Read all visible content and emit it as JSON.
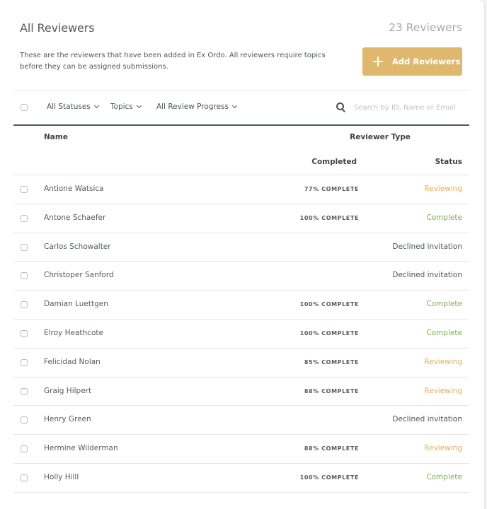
{
  "header": {
    "title": "All Reviewers",
    "count_label": "23 Reviewers",
    "description": "These are the reviewers that have been added in Ex Ordo. All reviewers require topics before they can be assigned submissions.",
    "add_button_label": "Add Reviewers",
    "add_button_icon": "plus-icon"
  },
  "colors": {
    "accent": "#dfb86e",
    "reviewing": "#e5ad55",
    "complete": "#7fad4e",
    "declined": "#4f5458",
    "header_rule": "#4e5860"
  },
  "toolbar": {
    "filters": [
      {
        "label": "All Statuses",
        "icon": "chevron-down-icon"
      },
      {
        "label": "Topics",
        "icon": "chevron-down-icon"
      },
      {
        "label": "All Review Progress",
        "icon": "chevron-down-icon"
      }
    ],
    "search": {
      "icon": "search-icon",
      "placeholder": "Search by ID, Name or Email",
      "value": ""
    }
  },
  "columns": {
    "name": "Name",
    "reviewer_type": "Reviewer Type",
    "completed": "Completed",
    "status": "Status"
  },
  "rows": [
    {
      "name": "Antione Watsica",
      "completed": "77% COMPLETE",
      "status": "Reviewing",
      "status_kind": "reviewing"
    },
    {
      "name": "Antone Schaefer",
      "completed": "100% COMPLETE",
      "status": "Complete",
      "status_kind": "complete"
    },
    {
      "name": "Carlos Schowalter",
      "completed": "",
      "status": "Declined invitation",
      "status_kind": "declined"
    },
    {
      "name": "Christoper Sanford",
      "completed": "",
      "status": "Declined invitation",
      "status_kind": "declined"
    },
    {
      "name": "Damian Luettgen",
      "completed": "100% COMPLETE",
      "status": "Complete",
      "status_kind": "complete"
    },
    {
      "name": "Elroy Heathcote",
      "completed": "100% COMPLETE",
      "status": "Complete",
      "status_kind": "complete"
    },
    {
      "name": "Felicidad Nolan",
      "completed": "85% COMPLETE",
      "status": "Reviewing",
      "status_kind": "reviewing"
    },
    {
      "name": "Graig Hilpert",
      "completed": "88% COMPLETE",
      "status": "Reviewing",
      "status_kind": "reviewing"
    },
    {
      "name": "Henry Green",
      "completed": "",
      "status": "Declined invitation",
      "status_kind": "declined"
    },
    {
      "name": "Hermine Wilderman",
      "completed": "88% COMPLETE",
      "status": "Reviewing",
      "status_kind": "reviewing"
    },
    {
      "name": "Holly Hilll",
      "completed": "100% COMPLETE",
      "status": "Complete",
      "status_kind": "complete"
    }
  ]
}
